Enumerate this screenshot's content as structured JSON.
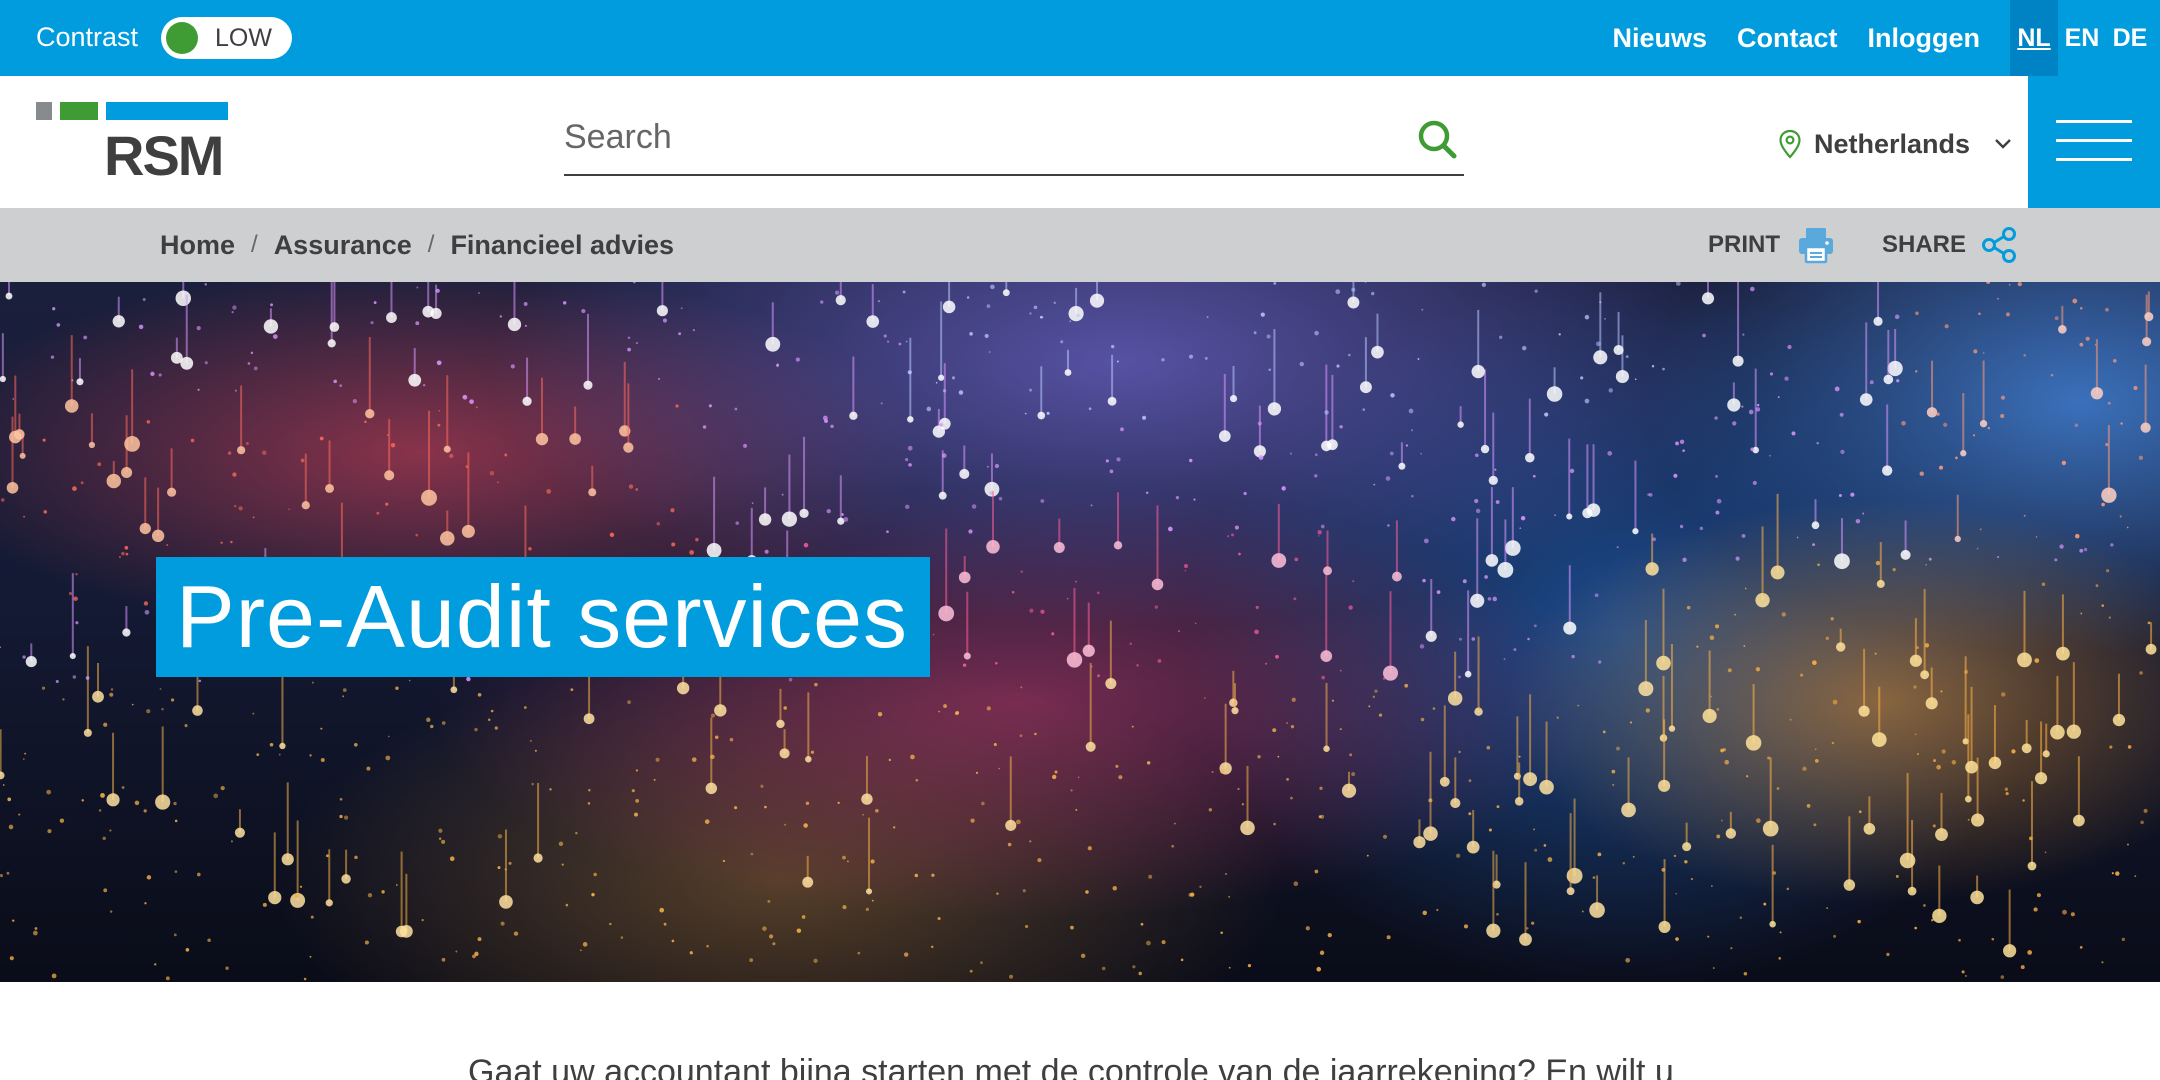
{
  "topbar": {
    "contrast_label": "Contrast",
    "contrast_state": "LOW",
    "links": {
      "news": "Nieuws",
      "contact": "Contact",
      "login": "Inloggen"
    },
    "languages": {
      "nl": "NL",
      "en": "EN",
      "de": "DE"
    },
    "active_language": "NL"
  },
  "header": {
    "logo_text": "RSM",
    "search": {
      "placeholder": "Search",
      "value": ""
    },
    "country": "Netherlands"
  },
  "breadcrumb": {
    "items": [
      "Home",
      "Assurance",
      "Financieel advies"
    ],
    "separator": "/",
    "print_label": "PRINT",
    "share_label": "SHARE"
  },
  "hero": {
    "title": "Pre-Audit services"
  },
  "intro": {
    "text": "Gaat uw accountant bijna starten met de controle van de jaarrekening? En wilt u"
  },
  "colors": {
    "brand_blue": "#009cde",
    "brand_green": "#3f9c35",
    "brand_grey": "#888b8d",
    "text_dark": "#3f3f3f",
    "breadcrumb_bg": "#cdcfd0"
  },
  "icons": {
    "search": "search-icon",
    "location": "map-pin-icon",
    "chevron": "chevron-down-icon",
    "menu": "hamburger-menu-icon",
    "print": "printer-icon",
    "share": "share-icon"
  }
}
